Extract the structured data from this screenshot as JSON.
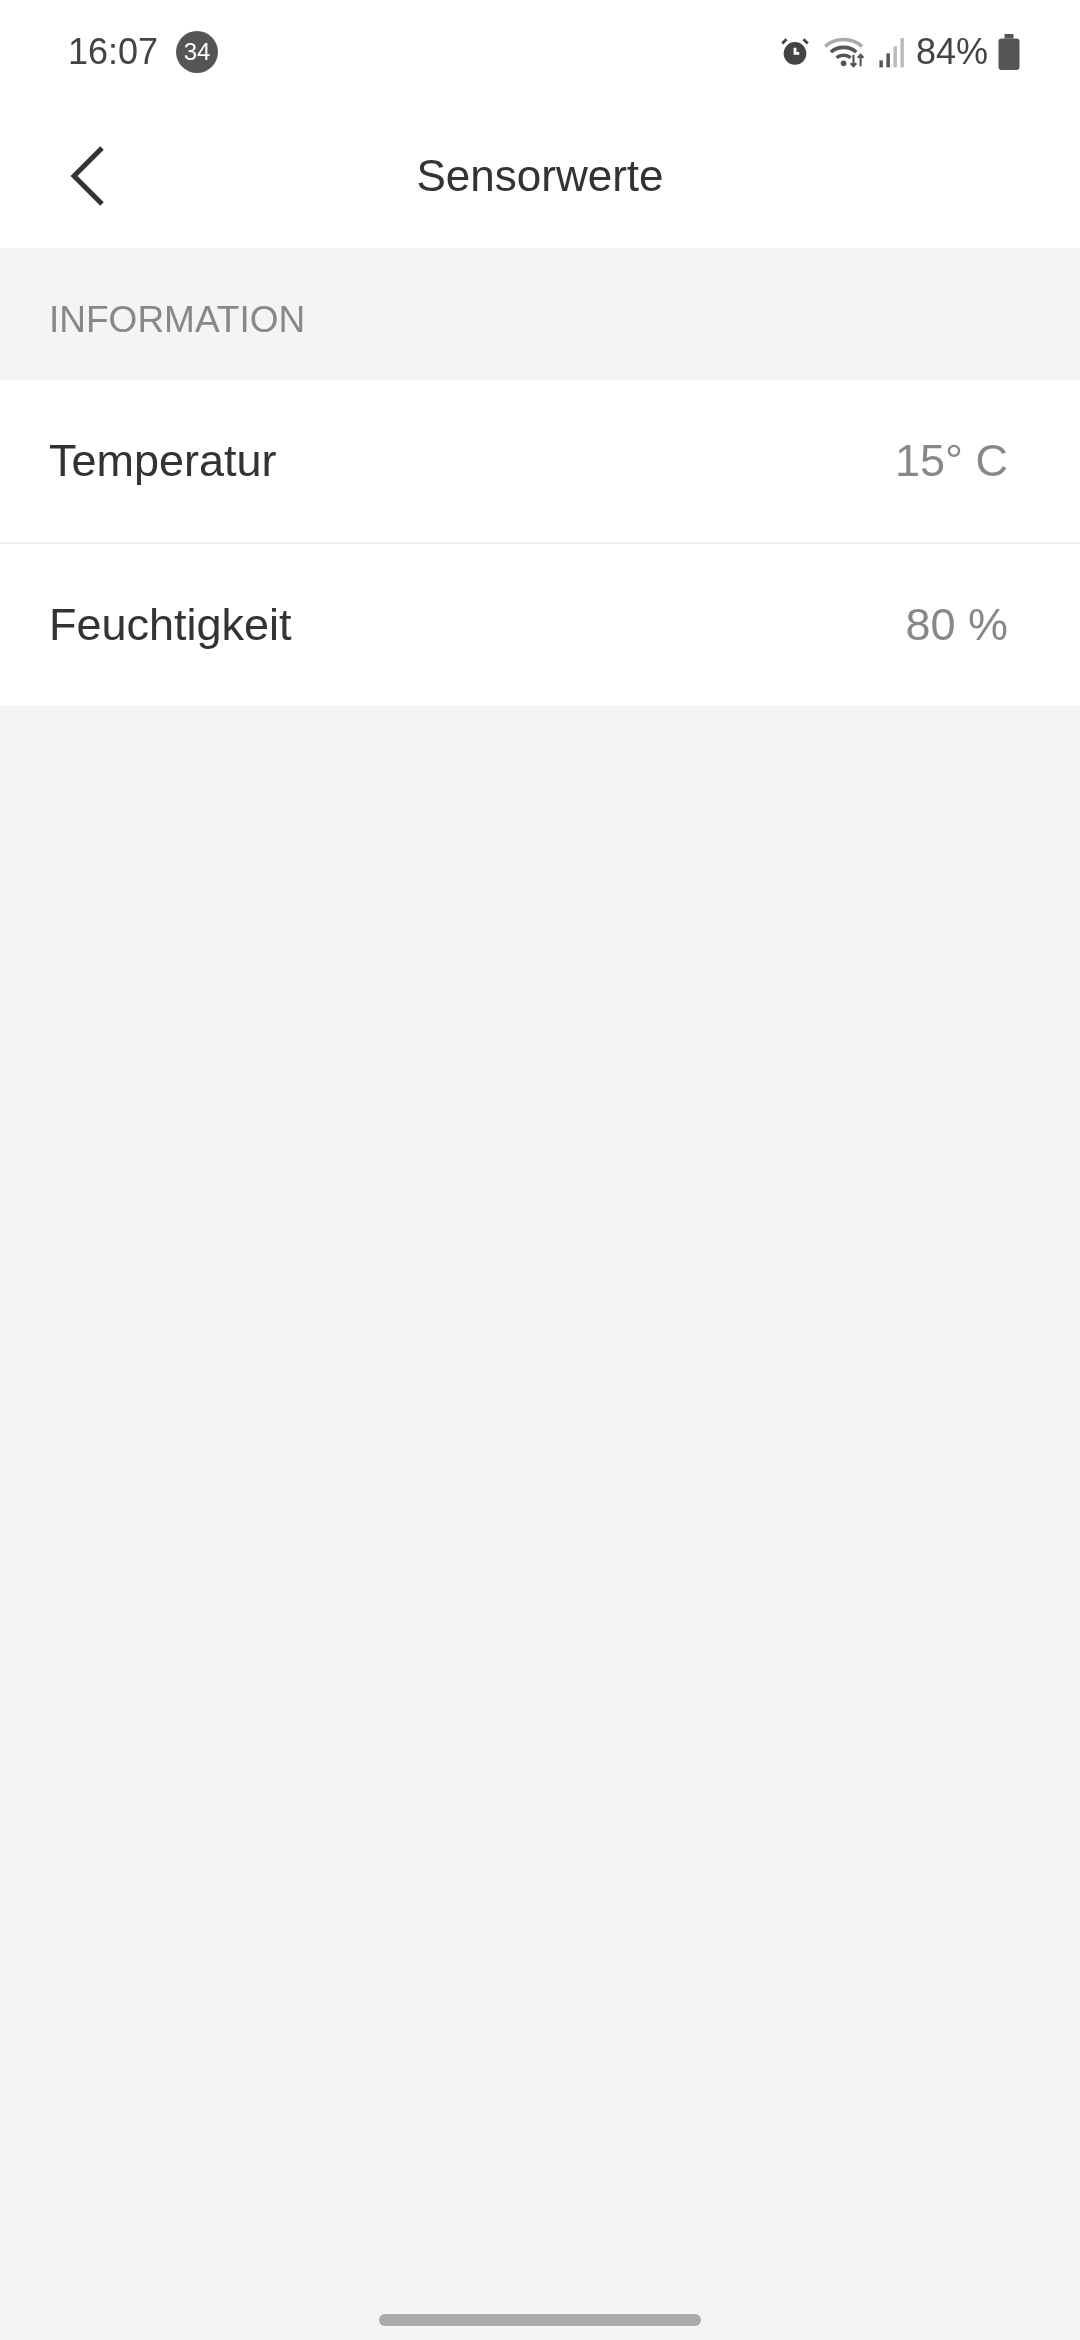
{
  "status_bar": {
    "time": "16:07",
    "notification_count": "34",
    "battery": "84%"
  },
  "app_bar": {
    "title": "Sensorwerte"
  },
  "section": {
    "title": "INFORMATION"
  },
  "rows": [
    {
      "label": "Temperatur",
      "value": "15° C"
    },
    {
      "label": "Feuchtigkeit",
      "value": "80 %"
    }
  ]
}
